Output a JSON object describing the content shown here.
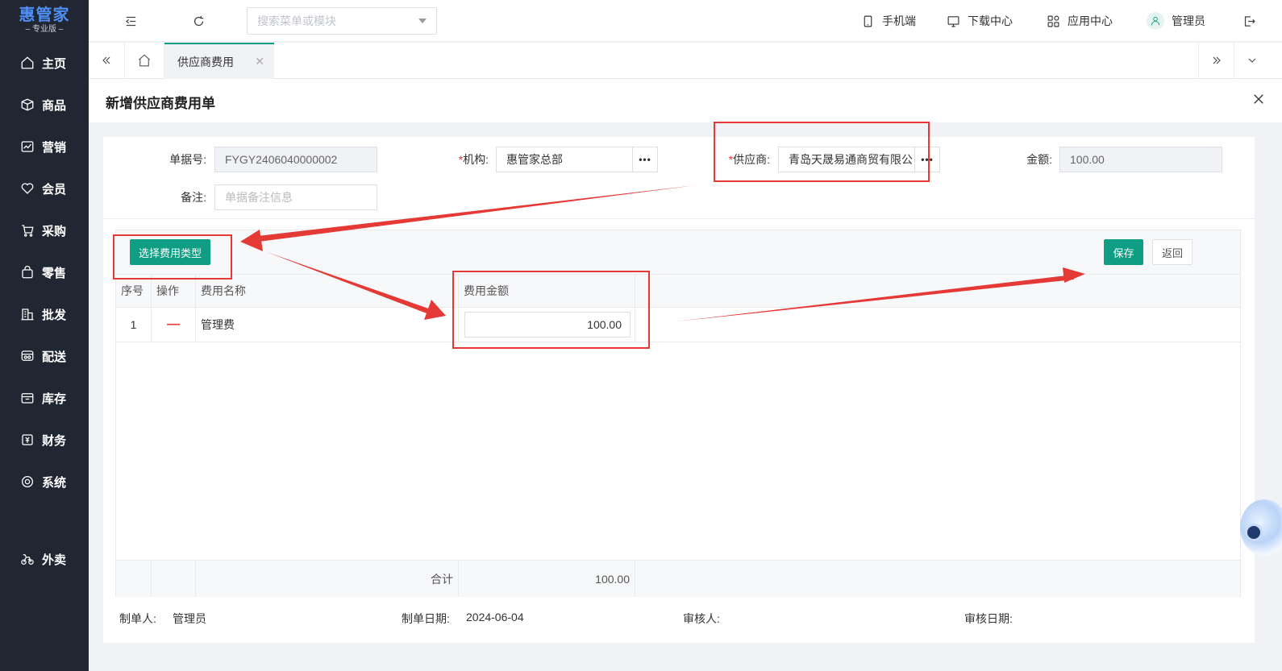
{
  "logo": {
    "name": "惠管家",
    "edition": "专业版"
  },
  "sidebar": {
    "items": [
      {
        "label": "主页",
        "icon": "home-icon"
      },
      {
        "label": "商品",
        "icon": "box-icon"
      },
      {
        "label": "营销",
        "icon": "trend-icon"
      },
      {
        "label": "会员",
        "icon": "heart-icon"
      },
      {
        "label": "采购",
        "icon": "cart-icon"
      },
      {
        "label": "零售",
        "icon": "bag-icon"
      },
      {
        "label": "批发",
        "icon": "building-icon"
      },
      {
        "label": "配送",
        "icon": "truck-icon"
      },
      {
        "label": "库存",
        "icon": "storage-icon"
      },
      {
        "label": "财务",
        "icon": "finance-icon"
      },
      {
        "label": "系统",
        "icon": "settings-icon"
      }
    ],
    "extra": {
      "label": "外卖",
      "icon": "bike-icon"
    }
  },
  "topbar": {
    "search_placeholder": "搜索菜单或模块",
    "mobile": "手机端",
    "download": "下载中心",
    "apps": "应用中心",
    "user": "管理员"
  },
  "tabs": {
    "active": "供应商费用"
  },
  "page": {
    "title": "新增供应商费用单"
  },
  "form": {
    "doc_no_label": "单据号:",
    "doc_no": "FYGY2406040000002",
    "org_label": "机构:",
    "org": "惠管家总部",
    "supplier_label": "供应商:",
    "supplier": "青岛天晟易通商贸有限公",
    "amount_label": "金额:",
    "amount": "100.00",
    "remark_label": "备注:",
    "remark_placeholder": "单据备注信息",
    "required_mark": "*"
  },
  "toolbar": {
    "select_fee_type": "选择费用类型",
    "save": "保存",
    "back": "返回"
  },
  "table": {
    "headers": {
      "seq": "序号",
      "op": "操作",
      "name": "费用名称",
      "amount": "费用金额"
    },
    "rows": [
      {
        "seq": "1",
        "op": "—",
        "name": "管理费",
        "amount": "100.00"
      }
    ],
    "footer": {
      "label": "合计",
      "total": "100.00"
    }
  },
  "footer": {
    "creator_label": "制单人:",
    "creator": "管理员",
    "created_date_label": "制单日期:",
    "created_date": "2024-06-04",
    "reviewer_label": "审核人:",
    "reviewer": "",
    "review_date_label": "审核日期:",
    "review_date": ""
  },
  "colors": {
    "primary": "#0f9d84",
    "sidebar": "#202733",
    "annotation": "#e53935"
  }
}
